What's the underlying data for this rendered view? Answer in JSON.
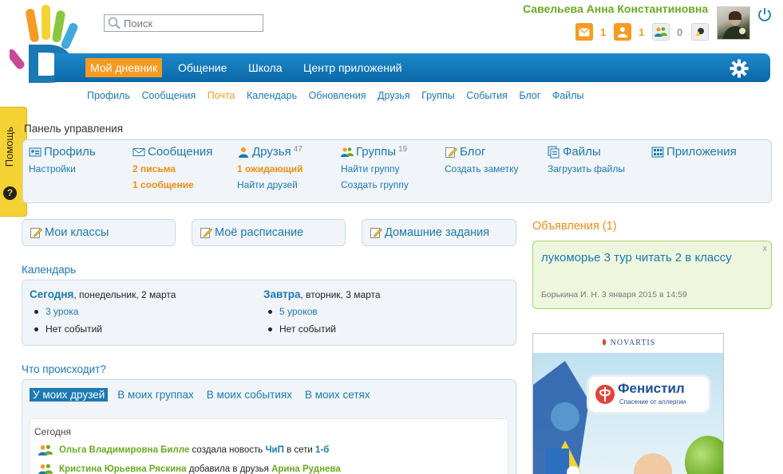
{
  "header": {
    "search_placeholder": "Поиск",
    "user_name": "Савельева Анна Константиновна",
    "notifications": [
      {
        "icon": "mail-icon",
        "count": "1"
      },
      {
        "icon": "user-icon",
        "count": "1"
      },
      {
        "icon": "group-icon",
        "count": "0"
      },
      {
        "icon": "event-icon",
        "count": ""
      }
    ]
  },
  "nav": {
    "items": [
      "Мой дневник",
      "Общение",
      "Школа",
      "Центр приложений"
    ],
    "active_index": 0
  },
  "subnav": [
    "Профиль",
    "Сообщения",
    "Почта",
    "Календарь",
    "Обновления",
    "Друзья",
    "Группы",
    "События",
    "Блог",
    "Файлы"
  ],
  "subnav_current": "Почта",
  "help_label": "Помощь",
  "panel_title": "Панель управления",
  "dashboard": [
    {
      "title": "Профиль",
      "count": "",
      "links": [
        "Настройки"
      ],
      "hot": []
    },
    {
      "title": "Сообщения",
      "count": "",
      "links": [
        "2 письма",
        "1 сообщение"
      ],
      "hot": [
        0,
        1
      ]
    },
    {
      "title": "Друзья",
      "count": "47",
      "links": [
        "1 ожидающий",
        "Найти друзей"
      ],
      "hot": [
        0
      ]
    },
    {
      "title": "Группы",
      "count": "19",
      "links": [
        "Найти группу",
        "Создать группу"
      ],
      "hot": []
    },
    {
      "title": "Блог",
      "count": "",
      "links": [
        "Создать заметку"
      ],
      "hot": []
    },
    {
      "title": "Файлы",
      "count": "",
      "links": [
        "Загрузить файлы"
      ],
      "hot": []
    },
    {
      "title": "Приложения",
      "count": "",
      "links": [],
      "hot": []
    }
  ],
  "quick_buttons": [
    "Мои классы",
    "Моё расписание",
    "Домашние задания"
  ],
  "calendar": {
    "title": "Календарь",
    "days": [
      {
        "name": "Сегодня",
        "date": ", понедельник, 2 марта",
        "items": [
          "3 урока",
          "Нет событий"
        ]
      },
      {
        "name": "Завтра",
        "date": ", вторник, 3 марта",
        "items": [
          "5 уроков",
          "Нет событий"
        ]
      }
    ]
  },
  "feed": {
    "title": "Что происходит?",
    "tabs": [
      "У моих друзей",
      "В моих группах",
      "В моих событиях",
      "В моих сетях"
    ],
    "active_tab": 0,
    "today_label": "Сегодня",
    "items": [
      {
        "person": "Ольга Владимировна Билле",
        "action": " создала новость ",
        "object": "ЧиП",
        "tail": " в сети ",
        "target": "1-б"
      },
      {
        "person": "Кристина Юрьевна Ряскина",
        "action": " добавила в друзья ",
        "object": "",
        "tail": "",
        "target": "Арина Руднева"
      }
    ]
  },
  "announcements": {
    "title": "Объявления (1)",
    "items": [
      {
        "text": "лукоморье 3 тур читать 2 в классу",
        "meta": "Борькина И. Н. 3 января 2015 в 14:59",
        "close": "x"
      }
    ]
  },
  "ad": {
    "sponsor": "NOVARTIS",
    "brand": "Фенистил",
    "tagline": "Спасение от аллергии"
  },
  "colors": {
    "brand_blue": "#1a79b2",
    "accent_orange": "#f59a23",
    "green": "#6aaa1e"
  }
}
